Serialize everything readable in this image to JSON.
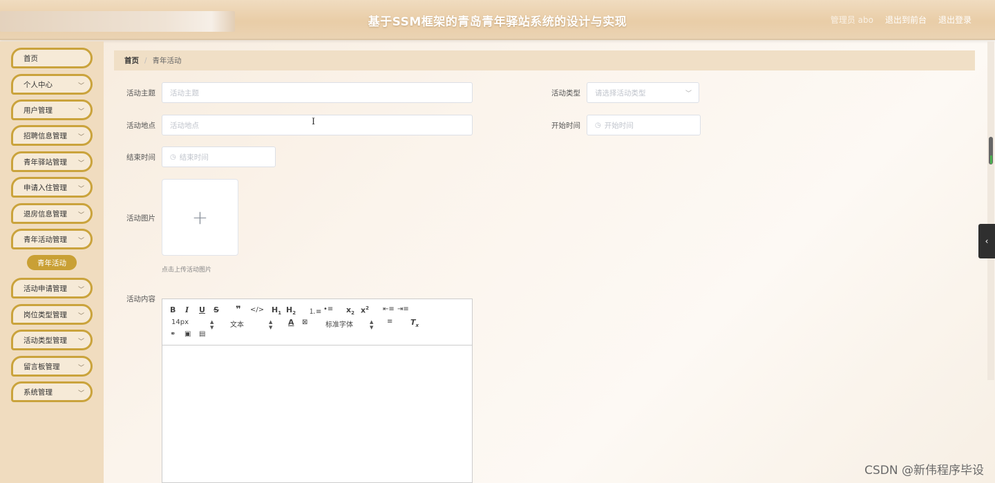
{
  "header": {
    "title": "基于SSM框架的青岛青年驿站系统的设计与实现",
    "user": "管理员 abo",
    "front_link": "退出到前台",
    "logout_link": "退出登录"
  },
  "sidebar": {
    "items": [
      {
        "label": "首页",
        "has_children": false
      },
      {
        "label": "个人中心",
        "has_children": true
      },
      {
        "label": "用户管理",
        "has_children": true
      },
      {
        "label": "招聘信息管理",
        "has_children": true
      },
      {
        "label": "青年驿站管理",
        "has_children": true
      },
      {
        "label": "申请入住管理",
        "has_children": true
      },
      {
        "label": "退房信息管理",
        "has_children": true
      },
      {
        "label": "青年活动管理",
        "has_children": true
      },
      {
        "label": "活动申请管理",
        "has_children": true
      },
      {
        "label": "岗位类型管理",
        "has_children": true
      },
      {
        "label": "活动类型管理",
        "has_children": true
      },
      {
        "label": "留言板管理",
        "has_children": true
      },
      {
        "label": "系统管理",
        "has_children": true
      }
    ],
    "active_sub": "青年活动"
  },
  "breadcrumb": {
    "home": "首页",
    "separator": "/",
    "current": "青年活动"
  },
  "form": {
    "theme": {
      "label": "活动主题",
      "placeholder": "活动主题"
    },
    "type": {
      "label": "活动类型",
      "placeholder": "请选择活动类型"
    },
    "location": {
      "label": "活动地点",
      "placeholder": "活动地点"
    },
    "start": {
      "label": "开始时间",
      "placeholder": "开始时间"
    },
    "end": {
      "label": "结束时间",
      "placeholder": "结束时间"
    },
    "image": {
      "label": "活动图片",
      "tip": "点击上传活动图片"
    },
    "content": {
      "label": "活动内容"
    }
  },
  "editor": {
    "font_size": "14px",
    "format": "文本",
    "font_family": "标准字体"
  },
  "watermark": "CSDN @新伟程序毕设",
  "colors": {
    "accent": "#c9a035",
    "sidebar_bg": "#f0dcbf"
  }
}
